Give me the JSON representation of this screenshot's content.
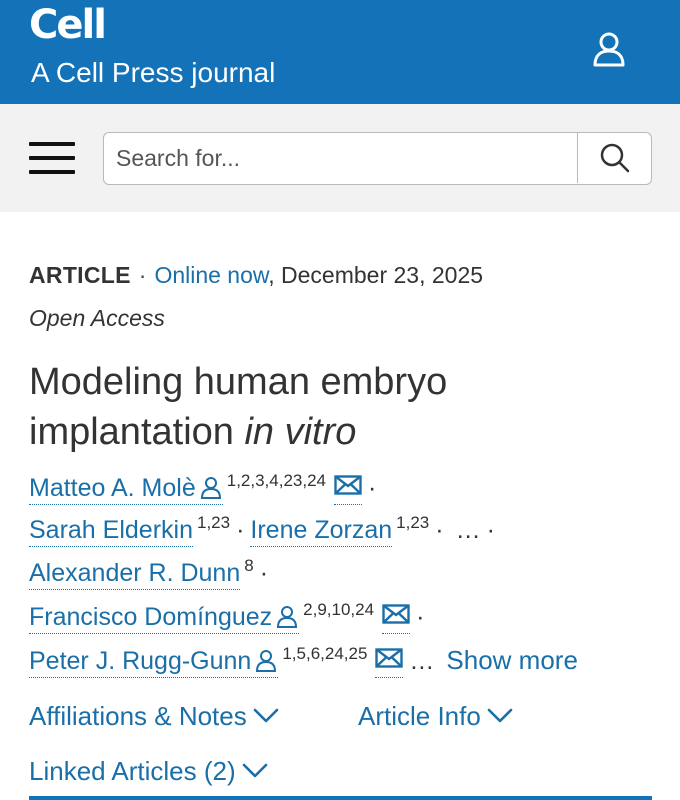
{
  "header": {
    "logo": "Cell",
    "subtitle": "A Cell Press journal"
  },
  "search": {
    "placeholder": "Search for..."
  },
  "article": {
    "type": "ARTICLE",
    "online_label": "Online now",
    "date": ", December 23, 2025",
    "access": "Open Access",
    "title_line1": "Modeling human embryo",
    "title_line2_plain": "implantation ",
    "title_line2_italic": "in vitro"
  },
  "authors": [
    {
      "name": "Matteo A. Molè",
      "affiliations": "1,2,3,4,23,24"
    },
    {
      "name": "Sarah Elderkin",
      "affiliations": "1,23"
    },
    {
      "name": "Irene Zorzan",
      "affiliations": "1,23"
    },
    {
      "name": "Alexander R. Dunn",
      "affiliations": "8"
    },
    {
      "name": "Francisco Domínguez",
      "affiliations": "2,9,10,24"
    },
    {
      "name": "Peter J. Rugg-Gunn",
      "affiliations": "1,5,6,24,25"
    }
  ],
  "authors_ui": {
    "separator": "·",
    "ellipsis": "…",
    "show_more": "Show more"
  },
  "sections": {
    "affiliations": "Affiliations & Notes",
    "article_info": "Article Info",
    "linked_articles": "Linked Articles (2)"
  },
  "colors": {
    "brand_blue": "#1372b8",
    "link_blue": "#1a6fa8",
    "search_bar_bg": "#f2f2f2"
  },
  "icons": {
    "account": "user-icon",
    "menu": "hamburger-menu-icon",
    "search": "search-icon",
    "author_profile": "person-icon",
    "author_email": "envelope-icon",
    "expand": "chevron-down-icon"
  }
}
